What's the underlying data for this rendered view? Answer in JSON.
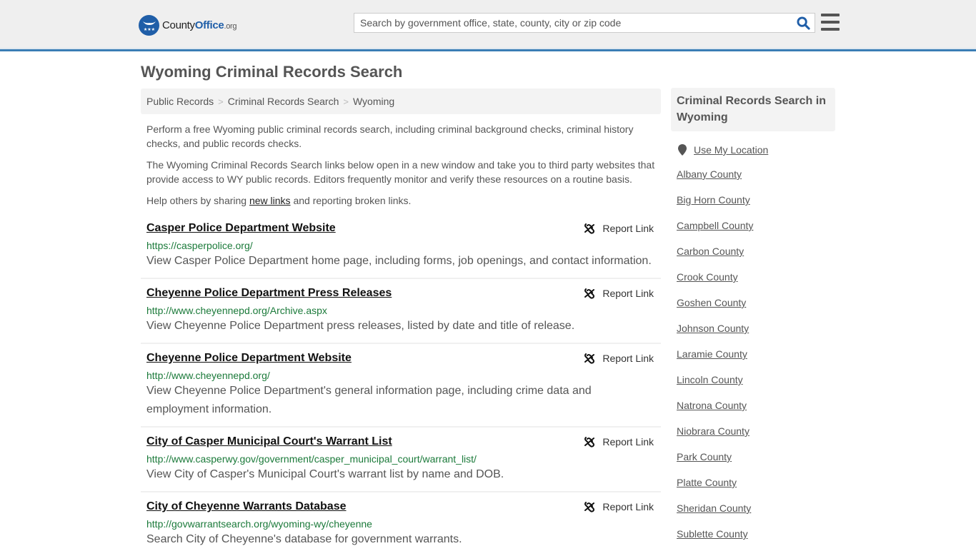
{
  "header": {
    "logo": {
      "name": "County",
      "highlight": "Office",
      "tld": ".org"
    },
    "search": {
      "placeholder": "Search by government office, state, county, city or zip code",
      "value": ""
    },
    "icons": {
      "search": "search-icon",
      "menu": "hamburger-menu-icon"
    }
  },
  "page": {
    "title": "Wyoming Criminal Records Search",
    "breadcrumb": [
      "Public Records",
      "Criminal Records Search",
      "Wyoming"
    ],
    "intro": {
      "p1": "Perform a free Wyoming public criminal records search, including criminal background checks, criminal history checks, and public records checks.",
      "p2": "The Wyoming Criminal Records Search links below open in a new window and take you to third party websites that provide access to WY public records. Editors frequently monitor and verify these resources on a routine basis.",
      "p3_before": "Help others by sharing ",
      "p3_link": "new links",
      "p3_after": " and reporting broken links."
    }
  },
  "results": [
    {
      "title": "Casper Police Department Website",
      "url": "https://casperpolice.org/",
      "description": "View Casper Police Department home page, including forms, job openings, and contact information.",
      "report_label": "Report Link"
    },
    {
      "title": "Cheyenne Police Department Press Releases",
      "url": "http://www.cheyennepd.org/Archive.aspx",
      "description": "View Cheyenne Police Department press releases, listed by date and title of release.",
      "report_label": "Report Link"
    },
    {
      "title": "Cheyenne Police Department Website",
      "url": "http://www.cheyennepd.org/",
      "description": "View Cheyenne Police Department's general information page, including crime data and employment information.",
      "report_label": "Report Link"
    },
    {
      "title": "City of Casper Municipal Court's Warrant List",
      "url": "http://www.casperwy.gov/government/casper_municipal_court/warrant_list/",
      "description": "View City of Casper's Municipal Court's warrant list by name and DOB.",
      "report_label": "Report Link"
    },
    {
      "title": "City of Cheyenne Warrants Database",
      "url": "http://govwarrantsearch.org/wyoming-wy/cheyenne",
      "description": "Search City of Cheyenne's database for government warrants.",
      "report_label": "Report Link"
    }
  ],
  "sidebar": {
    "heading": "Criminal Records Search in Wyoming",
    "use_location": "Use My Location",
    "counties": [
      "Albany County",
      "Big Horn County",
      "Campbell County",
      "Carbon County",
      "Crook County",
      "Goshen County",
      "Johnson County",
      "Laramie County",
      "Lincoln County",
      "Natrona County",
      "Niobrara County",
      "Park County",
      "Platte County",
      "Sheridan County",
      "Sublette County"
    ]
  },
  "colors": {
    "brand": "#1f5ea8",
    "header_border": "#3a7db5",
    "url_green": "#1b7a3a"
  }
}
